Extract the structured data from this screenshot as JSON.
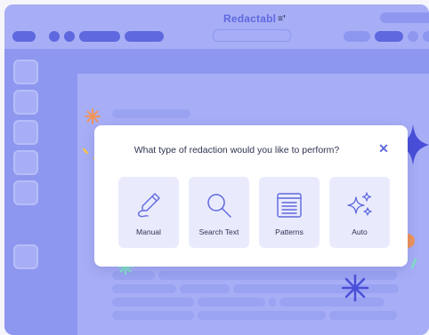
{
  "app": {
    "logo_text": "Redactabl",
    "logo_mark": "≡'"
  },
  "dialog": {
    "title": "What type of redaction would you like to perform?",
    "close_glyph": "✕",
    "options": [
      {
        "label": "Manual",
        "icon": "pen-icon"
      },
      {
        "label": "Search Text",
        "icon": "magnifier-icon"
      },
      {
        "label": "Patterns",
        "icon": "document-lines-icon"
      },
      {
        "label": "Auto",
        "icon": "sparkles-icon"
      }
    ]
  },
  "colors": {
    "accent": "#5f68de",
    "frame": "#8e97ef",
    "canvas": "#a7aef6",
    "option_bg": "#e9ebfd",
    "orange": "#f0945a",
    "teal": "#7fe0c8",
    "navy_star": "#4a4fd9"
  }
}
